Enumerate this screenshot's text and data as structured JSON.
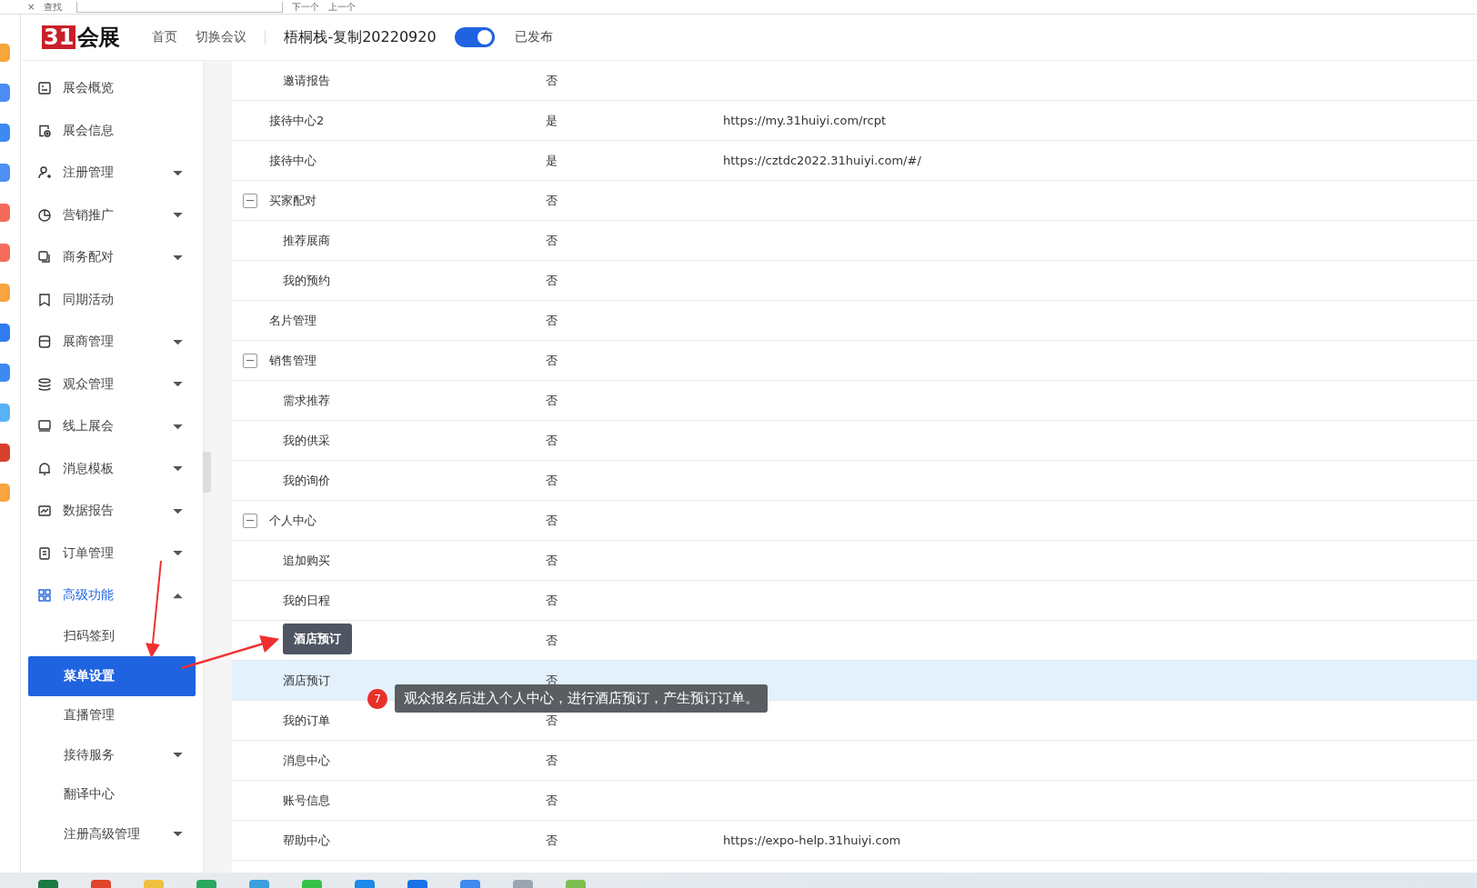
{
  "find_bar": {
    "close": "×",
    "label": "查找",
    "next": "下一个",
    "prev": "上一个"
  },
  "header": {
    "logo_mark": "31",
    "logo_text": "会展",
    "nav": [
      "首页",
      "切换会议"
    ],
    "event_title": "梧桐栈-复制20220920",
    "published_toggle": {
      "on": true
    },
    "status": "已发布"
  },
  "sidebar": {
    "items": [
      {
        "label": "展会概览",
        "has_caret": false,
        "expanded": false,
        "selected": false
      },
      {
        "label": "展会信息",
        "has_caret": false,
        "expanded": false,
        "selected": false
      },
      {
        "label": "注册管理",
        "has_caret": true,
        "expanded": false,
        "selected": false
      },
      {
        "label": "营销推广",
        "has_caret": true,
        "expanded": false,
        "selected": false
      },
      {
        "label": "商务配对",
        "has_caret": true,
        "expanded": false,
        "selected": false
      },
      {
        "label": "同期活动",
        "has_caret": false,
        "expanded": false,
        "selected": false
      },
      {
        "label": "展商管理",
        "has_caret": true,
        "expanded": false,
        "selected": false
      },
      {
        "label": "观众管理",
        "has_caret": true,
        "expanded": false,
        "selected": false
      },
      {
        "label": "线上展会",
        "has_caret": true,
        "expanded": false,
        "selected": false
      },
      {
        "label": "消息模板",
        "has_caret": true,
        "expanded": false,
        "selected": false
      },
      {
        "label": "数据报告",
        "has_caret": true,
        "expanded": false,
        "selected": false
      },
      {
        "label": "订单管理",
        "has_caret": true,
        "expanded": false,
        "selected": false
      },
      {
        "label": "高级功能",
        "has_caret": true,
        "expanded": true,
        "selected": false,
        "children": [
          {
            "label": "扫码签到",
            "has_caret": false,
            "expanded": false,
            "selected": false
          },
          {
            "label": "菜单设置",
            "has_caret": false,
            "expanded": false,
            "selected": true
          },
          {
            "label": "直播管理",
            "has_caret": false,
            "expanded": false,
            "selected": false
          },
          {
            "label": "接待服务",
            "has_caret": true,
            "expanded": false,
            "selected": false
          },
          {
            "label": "翻译中心",
            "has_caret": false,
            "expanded": false,
            "selected": false
          },
          {
            "label": "注册高级管理",
            "has_caret": true,
            "expanded": false,
            "selected": false
          }
        ]
      }
    ]
  },
  "table": {
    "rows": [
      {
        "children": [
          {
            "name": "邀请报告",
            "shown": "否",
            "selected": false
          }
        ]
      },
      {
        "name": "接待中心2",
        "shown": "是",
        "url": "https://my.31huiyi.com/rcpt",
        "selected": false
      },
      {
        "name": "接待中心",
        "shown": "是",
        "url": "https://cztdc2022.31huiyi.com/#/",
        "selected": false
      },
      {
        "name": "买家配对",
        "shown": "否",
        "expanded": true,
        "selected": false,
        "children": [
          {
            "name": "推荐展商",
            "shown": "否",
            "selected": false
          },
          {
            "name": "我的预约",
            "shown": "否",
            "selected": false
          }
        ]
      },
      {
        "name": "名片管理",
        "shown": "否",
        "selected": false
      },
      {
        "name": "销售管理",
        "shown": "否",
        "expanded": true,
        "selected": false,
        "children": [
          {
            "name": "需求推荐",
            "shown": "否",
            "selected": false
          },
          {
            "name": "我的供采",
            "shown": "否",
            "selected": false
          },
          {
            "name": "我的询价",
            "shown": "否",
            "selected": false
          }
        ]
      },
      {
        "name": "个人中心",
        "shown": "否",
        "expanded": true,
        "selected": false,
        "children": [
          {
            "name": "追加购买",
            "shown": "否",
            "selected": false
          },
          {
            "name": "我的日程",
            "shown": "否",
            "selected": false
          },
          {
            "shown": "否",
            "selected": false
          },
          {
            "name": "酒店预订",
            "shown": "否",
            "selected": true
          },
          {
            "name": "我的订单",
            "shown": "否",
            "selected": false
          },
          {
            "name": "消息中心",
            "shown": "否",
            "selected": false
          },
          {
            "name": "账号信息",
            "shown": "否",
            "selected": false
          },
          {
            "name": "帮助中心",
            "shown": "否",
            "url": "https://expo-help.31huiyi.com",
            "selected": false
          }
        ]
      }
    ]
  },
  "annotations": {
    "tooltip": "酒店预订",
    "step_number": "7",
    "note": "观众报名后进入个人中心，进行酒店预订，产生预订订单。"
  }
}
